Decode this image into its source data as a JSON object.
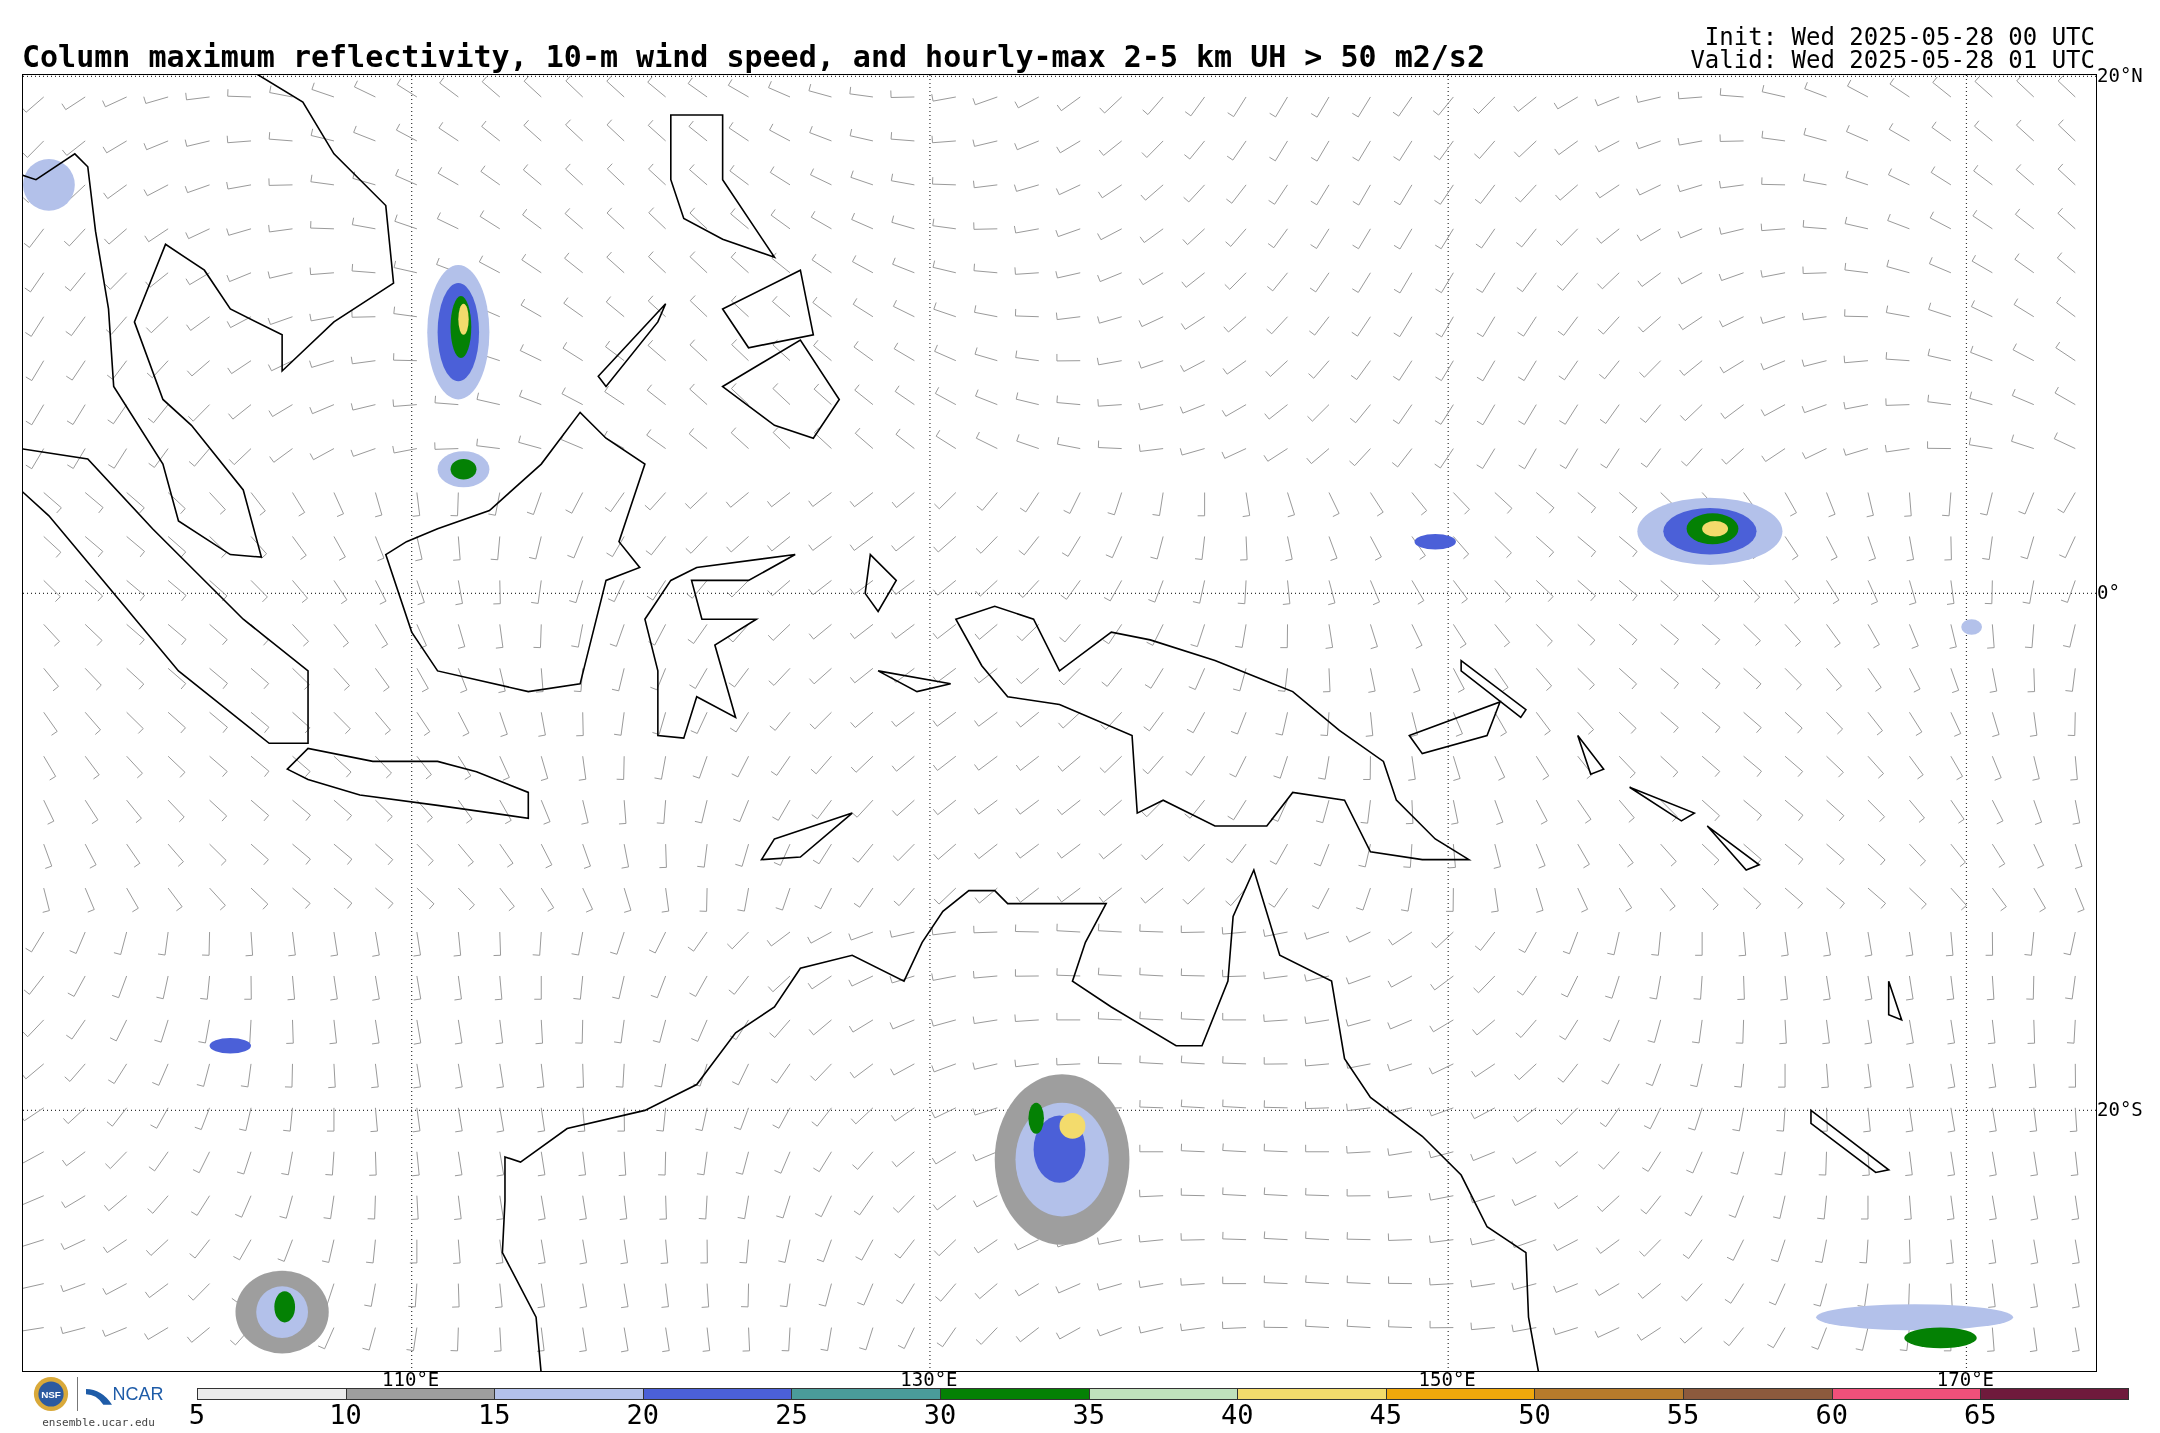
{
  "title": "Column maximum reflectivity, 10-m wind speed, and hourly-max 2-5 km UH > 50 m2/s2",
  "init": "Init: Wed 2025-05-28 00 UTC",
  "valid": "Valid: Wed 2025-05-28 01 UTC",
  "map": {
    "latitude_labels": [
      "20°N",
      "0°",
      "20°S"
    ],
    "longitude_labels": [
      "110°E",
      "130°E",
      "150°E",
      "170°E"
    ]
  },
  "logos": {
    "nsf": "NSF",
    "ncar": "NCAR",
    "site": "ensemble.ucar.edu"
  },
  "colorbar": [
    {
      "label": "5",
      "color": "#ebebeb"
    },
    {
      "label": "10",
      "color": "#9e9e9e"
    },
    {
      "label": "15",
      "color": "#b3c1ea"
    },
    {
      "label": "20",
      "color": "#4b60d8"
    },
    {
      "label": "25",
      "color": "#4a9b9a"
    },
    {
      "label": "30",
      "color": "#048104"
    },
    {
      "label": "35",
      "color": "#c0e1bc"
    },
    {
      "label": "40",
      "color": "#f3db6c"
    },
    {
      "label": "45",
      "color": "#f0a80b"
    },
    {
      "label": "50",
      "color": "#b77b2b"
    },
    {
      "label": "55",
      "color": "#8c5a3d"
    },
    {
      "label": "60",
      "color": "#f0507a"
    },
    {
      "label": "65",
      "color": "#6f1a3c"
    }
  ]
}
